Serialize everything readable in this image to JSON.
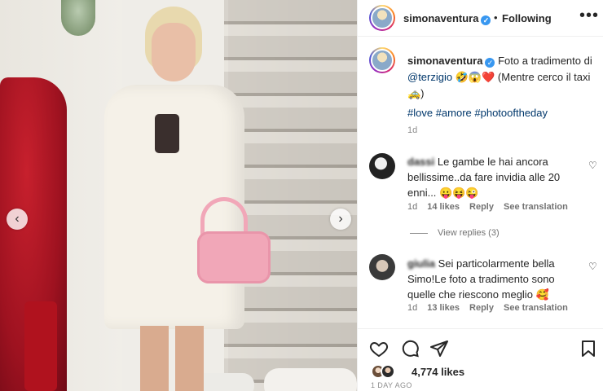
{
  "post": {
    "image_alt": "",
    "nav_prev_icon": "chevron-left-icon",
    "nav_next_icon": "chevron-right-icon"
  },
  "header": {
    "username": "simonaventura",
    "separator": "•",
    "follow_status": "Following",
    "more_icon": "•••"
  },
  "caption": {
    "username": "simonaventura",
    "text_before_mention": "Foto a tradimento di",
    "mention": "@terzigio",
    "emojis_1": "🤣😱❤️",
    "text_after": "(Mentre cerco il taxi",
    "emoji_2": "🚕)",
    "hashtags": "#love #amore #photooftheday",
    "time": "1d"
  },
  "comments": [
    {
      "username": "dassi",
      "text": "Le gambe le hai ancora bellissime..da fare invidia alle 20 enni...",
      "emojis": "😛😝😜",
      "time": "1d",
      "likes": "14 likes",
      "reply": "Reply",
      "translate": "See translation",
      "view_replies": "View replies (3)"
    },
    {
      "username": "giulia",
      "text": "Sei particolarmente bella Simo!Le foto a tradimento sono quelle che riescono meglio",
      "emojis": "🥰",
      "time": "1d",
      "likes": "13 likes",
      "reply": "Reply",
      "translate": "See translation"
    }
  ],
  "actions": {
    "likes_count": "4,774 likes",
    "time_ago": "1 DAY AGO"
  },
  "colors": {
    "link": "#00376b",
    "muted": "#737373",
    "verified": "#3897f0",
    "text": "#262626"
  }
}
